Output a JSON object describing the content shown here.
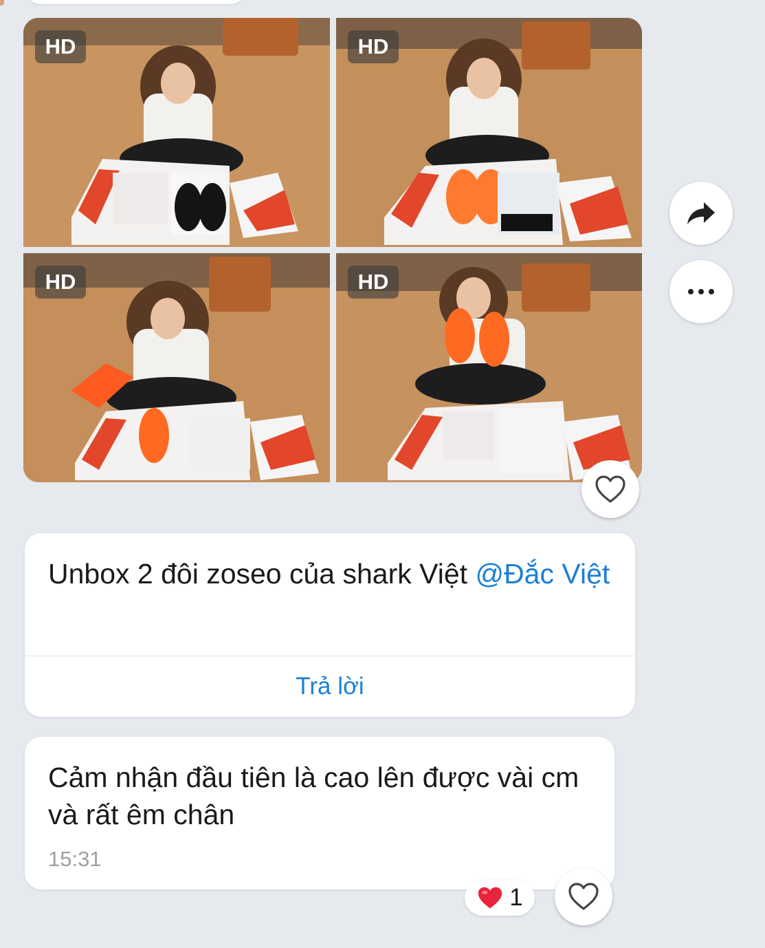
{
  "gallery": {
    "badge": "HD"
  },
  "messages": [
    {
      "text": "Unbox 2 đôi zoseo của shark Việt ",
      "mention": "@Đắc Việt",
      "reply_label": "Trả lời"
    },
    {
      "text": "Cảm nhận đầu tiên là cao lên được vài cm và rất êm chân",
      "time": "15:31",
      "reaction_emoji": "❤️",
      "reaction_count": "1"
    }
  ],
  "icons": {
    "share": "share-arrow-icon",
    "more": "more-dots-icon",
    "like": "heart-outline-icon",
    "reaction": "red-heart-icon"
  },
  "colors": {
    "background": "#e6e9ee",
    "bubble": "#ffffff",
    "link": "#1b7fd6",
    "timestamp": "#9aa0a6",
    "reaction_heart": "#e8233a"
  }
}
